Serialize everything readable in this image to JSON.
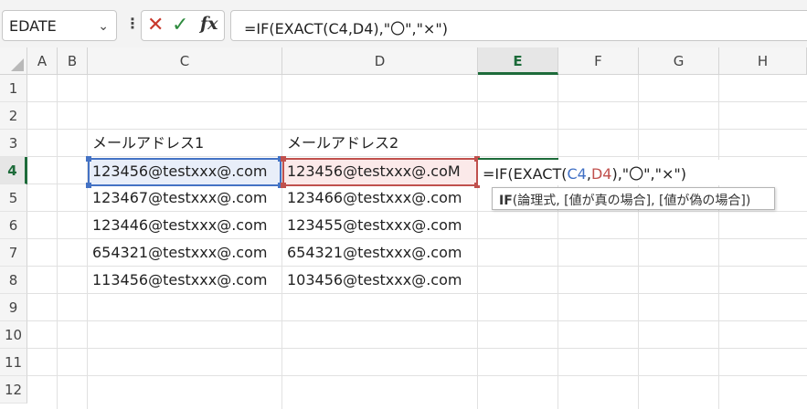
{
  "formula_bar": {
    "name_box": "EDATE",
    "formula": "=IF(EXACT(C4,D4),\"〇\",\"×\")"
  },
  "columns": [
    "A",
    "B",
    "C",
    "D",
    "E",
    "F",
    "G",
    "H"
  ],
  "selected_column": "E",
  "rows": [
    "1",
    "2",
    "3",
    "4",
    "5",
    "6",
    "7",
    "8",
    "9",
    "10",
    "11",
    "12"
  ],
  "selected_row": "4",
  "cells": {
    "C3": "メールアドレス1",
    "D3": "メールアドレス2",
    "C4": "123456@testxxx@.com",
    "D4": "123456@testxxx@.coM",
    "C5": "123467@testxxx@.com",
    "D5": "123466@testxxx@.com",
    "C6": "123446@testxxx@.com",
    "D6": "123455@testxxx@.com",
    "C7": "654321@testxxx@.com",
    "D7": "654321@testxxx@.com",
    "C8": "113456@testxxx@.com",
    "D8": "103456@testxxx@.com"
  },
  "edit": {
    "part1": "=IF(EXACT(",
    "ref1": "C4",
    "comma": ",",
    "ref2": "D4",
    "part2": "),\"〇\",\"×\")"
  },
  "tooltip": {
    "fn": "IF",
    "args": "(論理式, [値が真の場合], [値が偽の場合])"
  },
  "colors": {
    "accent": "#1d6b3a",
    "ref_blue": "#4472c4",
    "ref_red": "#c0504d"
  }
}
